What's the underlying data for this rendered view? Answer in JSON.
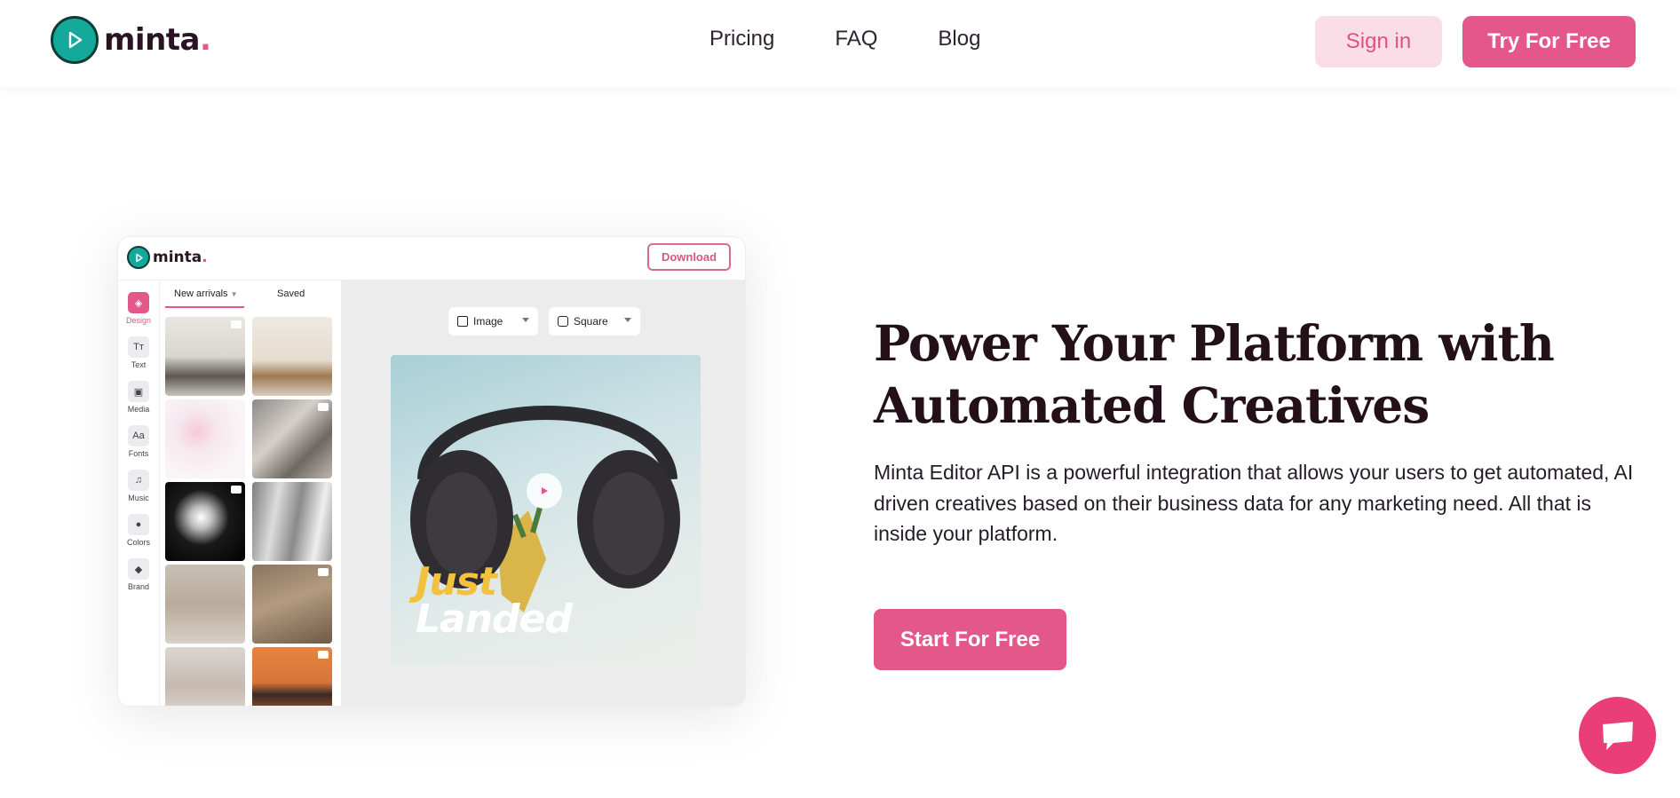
{
  "header": {
    "logo_text": "minta",
    "logo_dot": ".",
    "nav": [
      "Pricing",
      "FAQ",
      "Blog"
    ],
    "sign_in": "Sign in",
    "try_free": "Try For Free"
  },
  "editor": {
    "logo_text": "minta",
    "logo_dot": ".",
    "download": "Download",
    "rail": [
      "Design",
      "Text",
      "Media",
      "Fonts",
      "Music",
      "Colors",
      "Brand"
    ],
    "tabs": [
      "New arrivals",
      "Saved"
    ],
    "chips": [
      "Image",
      "Square"
    ],
    "canvas_text_1": "Just",
    "canvas_text_2": "Landed"
  },
  "hero": {
    "title_line1": "Power Your Platform with",
    "title_line2": "Automated Creatives",
    "description": "Minta Editor API is a powerful integration that allows your users to get automated, AI driven creatives based on their business data for any marketing need. All that is inside your platform.",
    "cta": "Start For Free"
  },
  "colors": {
    "brand_pink": "#e35888",
    "brand_teal": "#14a99a",
    "chat_pink": "#ea3e78"
  }
}
